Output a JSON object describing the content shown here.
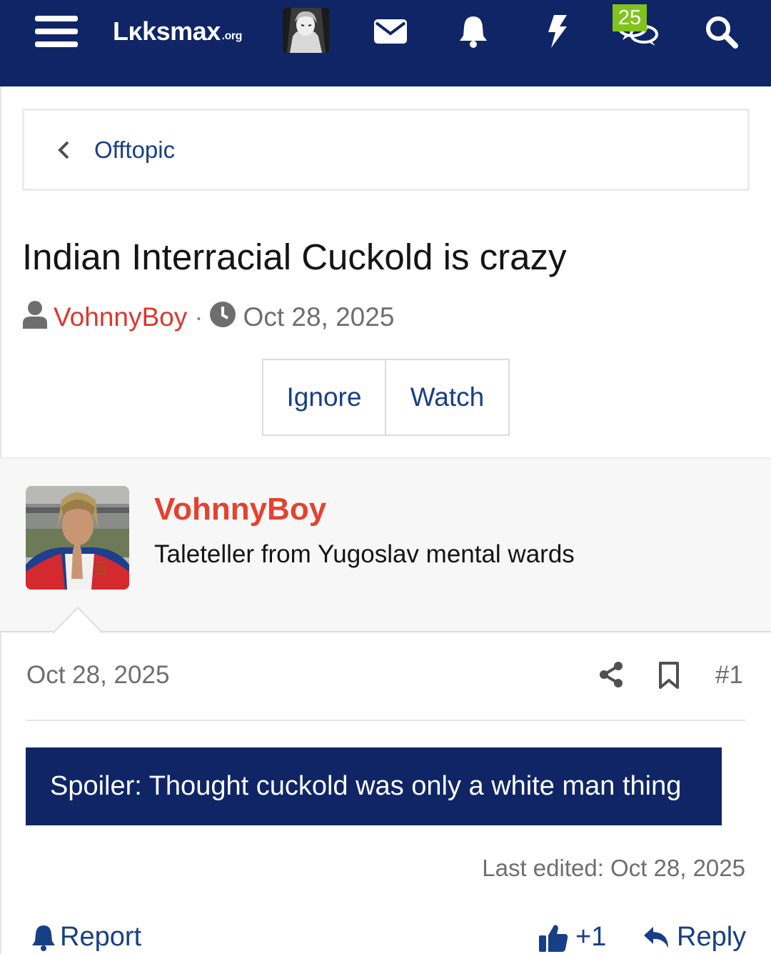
{
  "header": {
    "logo_text": "Lκksmax",
    "logo_suffix": ".org",
    "conversations_badge": "25",
    "icons": [
      "menu-icon",
      "user-avatar",
      "mail-icon",
      "bell-icon",
      "bolt-icon",
      "conversations-icon",
      "search-icon"
    ],
    "bg_color": "#0f2566",
    "badge_color": "#80c31d"
  },
  "breadcrumb": {
    "label": "Offtopic"
  },
  "thread": {
    "title": "Indian Interracial Cuckold is crazy",
    "author": "VohnnyBoy",
    "separator": "·",
    "date": "Oct 28, 2025",
    "ignore_label": "Ignore",
    "watch_label": "Watch"
  },
  "post": {
    "author": "VohnnyBoy",
    "user_title": "Taleteller from Yugoslav mental wards",
    "date": "Oct 28, 2025",
    "number": "#1",
    "spoiler_label": "Spoiler: Thought cuckold was only a white man thing",
    "last_edited": "Last edited: Oct 28, 2025",
    "report_label": "Report",
    "reaction_count": "+1",
    "reply_label": "Reply",
    "author_color": "#e4422f",
    "link_color": "#183f86"
  }
}
